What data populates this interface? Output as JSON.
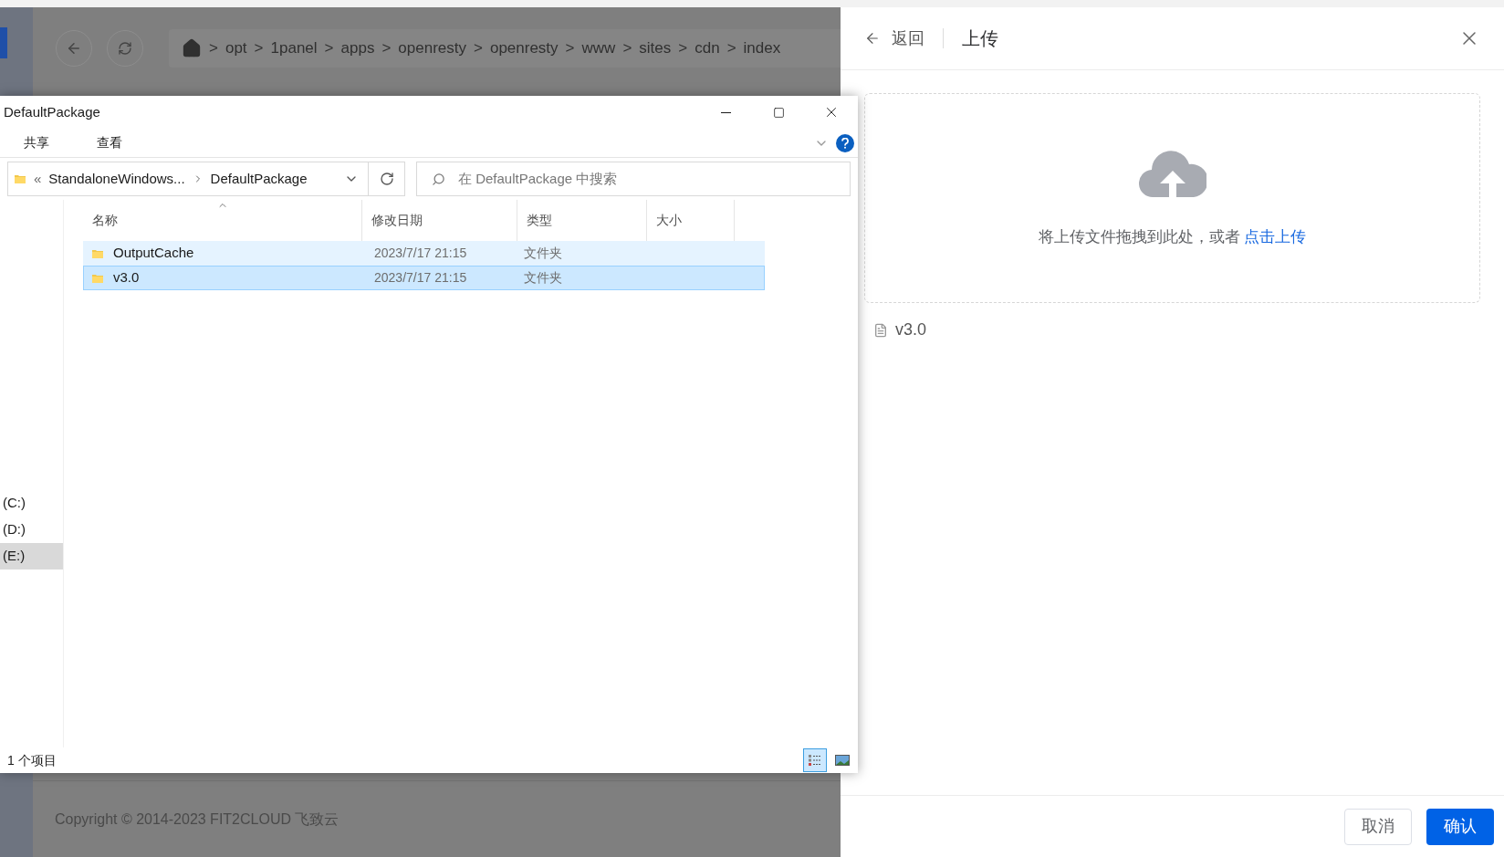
{
  "background_page": {
    "separator": ">",
    "breadcrumb": [
      "opt",
      "1panel",
      "apps",
      "openresty",
      "openresty",
      "www",
      "sites",
      "cdn",
      "index"
    ],
    "footer": "Copyright © 2014-2023 FIT2CLOUD 飞致云"
  },
  "explorer": {
    "title": "DefaultPackage",
    "ribbon_tabs": [
      "共享",
      "查看"
    ],
    "address": {
      "overflow": "«",
      "parts": [
        "StandaloneWindows...",
        "DefaultPackage"
      ]
    },
    "search": {
      "placeholder": "在 DefaultPackage 中搜索"
    },
    "columns": [
      {
        "label": "名称",
        "sorted": true
      },
      {
        "label": "修改日期",
        "sorted": false
      },
      {
        "label": "类型",
        "sorted": false
      },
      {
        "label": "大小",
        "sorted": false
      }
    ],
    "rows": [
      {
        "name": "OutputCache",
        "modified": "2023/7/17 21:15",
        "type": "文件夹",
        "selected": false,
        "hovered": true
      },
      {
        "name": "v3.0",
        "modified": "2023/7/17 21:15",
        "type": "文件夹",
        "selected": true,
        "hovered": false
      }
    ],
    "nav_items": [
      {
        "label": "(C:)",
        "selected": false
      },
      {
        "label": "(D:)",
        "selected": false
      },
      {
        "label": "(E:)",
        "selected": true
      }
    ],
    "status": "1 个项目",
    "views": [
      {
        "kind": "details",
        "selected": true
      },
      {
        "kind": "thumbnails",
        "selected": false
      }
    ]
  },
  "drawer": {
    "back": "返回",
    "title": "上传",
    "dropzone": {
      "text": "将上传文件拖拽到此处，或者",
      "link": "点击上传"
    },
    "files": [
      "v3.0"
    ],
    "buttons": [
      {
        "label": "取消",
        "kind": "default"
      },
      {
        "label": "确认",
        "kind": "primary"
      }
    ]
  }
}
